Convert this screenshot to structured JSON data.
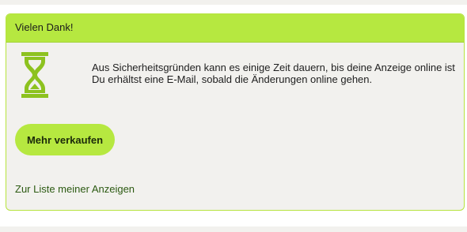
{
  "panel": {
    "header_title": "Vielen Dank!",
    "message_line1": "Aus Sicherheitsgründen kann es einige Zeit dauern, bis deine Anzeige online ist",
    "message_line2": "Du erhältst eine E-Mail, sobald die Änderungen online gehen.",
    "sell_button_label": "Mehr verkaufen",
    "list_link_label": "Zur Liste meiner Anzeigen"
  },
  "icons": {
    "status_icon": "hourglass-icon"
  },
  "colors": {
    "accent_green": "#b6e840",
    "icon_green": "#8dc21f",
    "panel_background": "#f2f1ee",
    "link_green": "#2c5a12"
  }
}
